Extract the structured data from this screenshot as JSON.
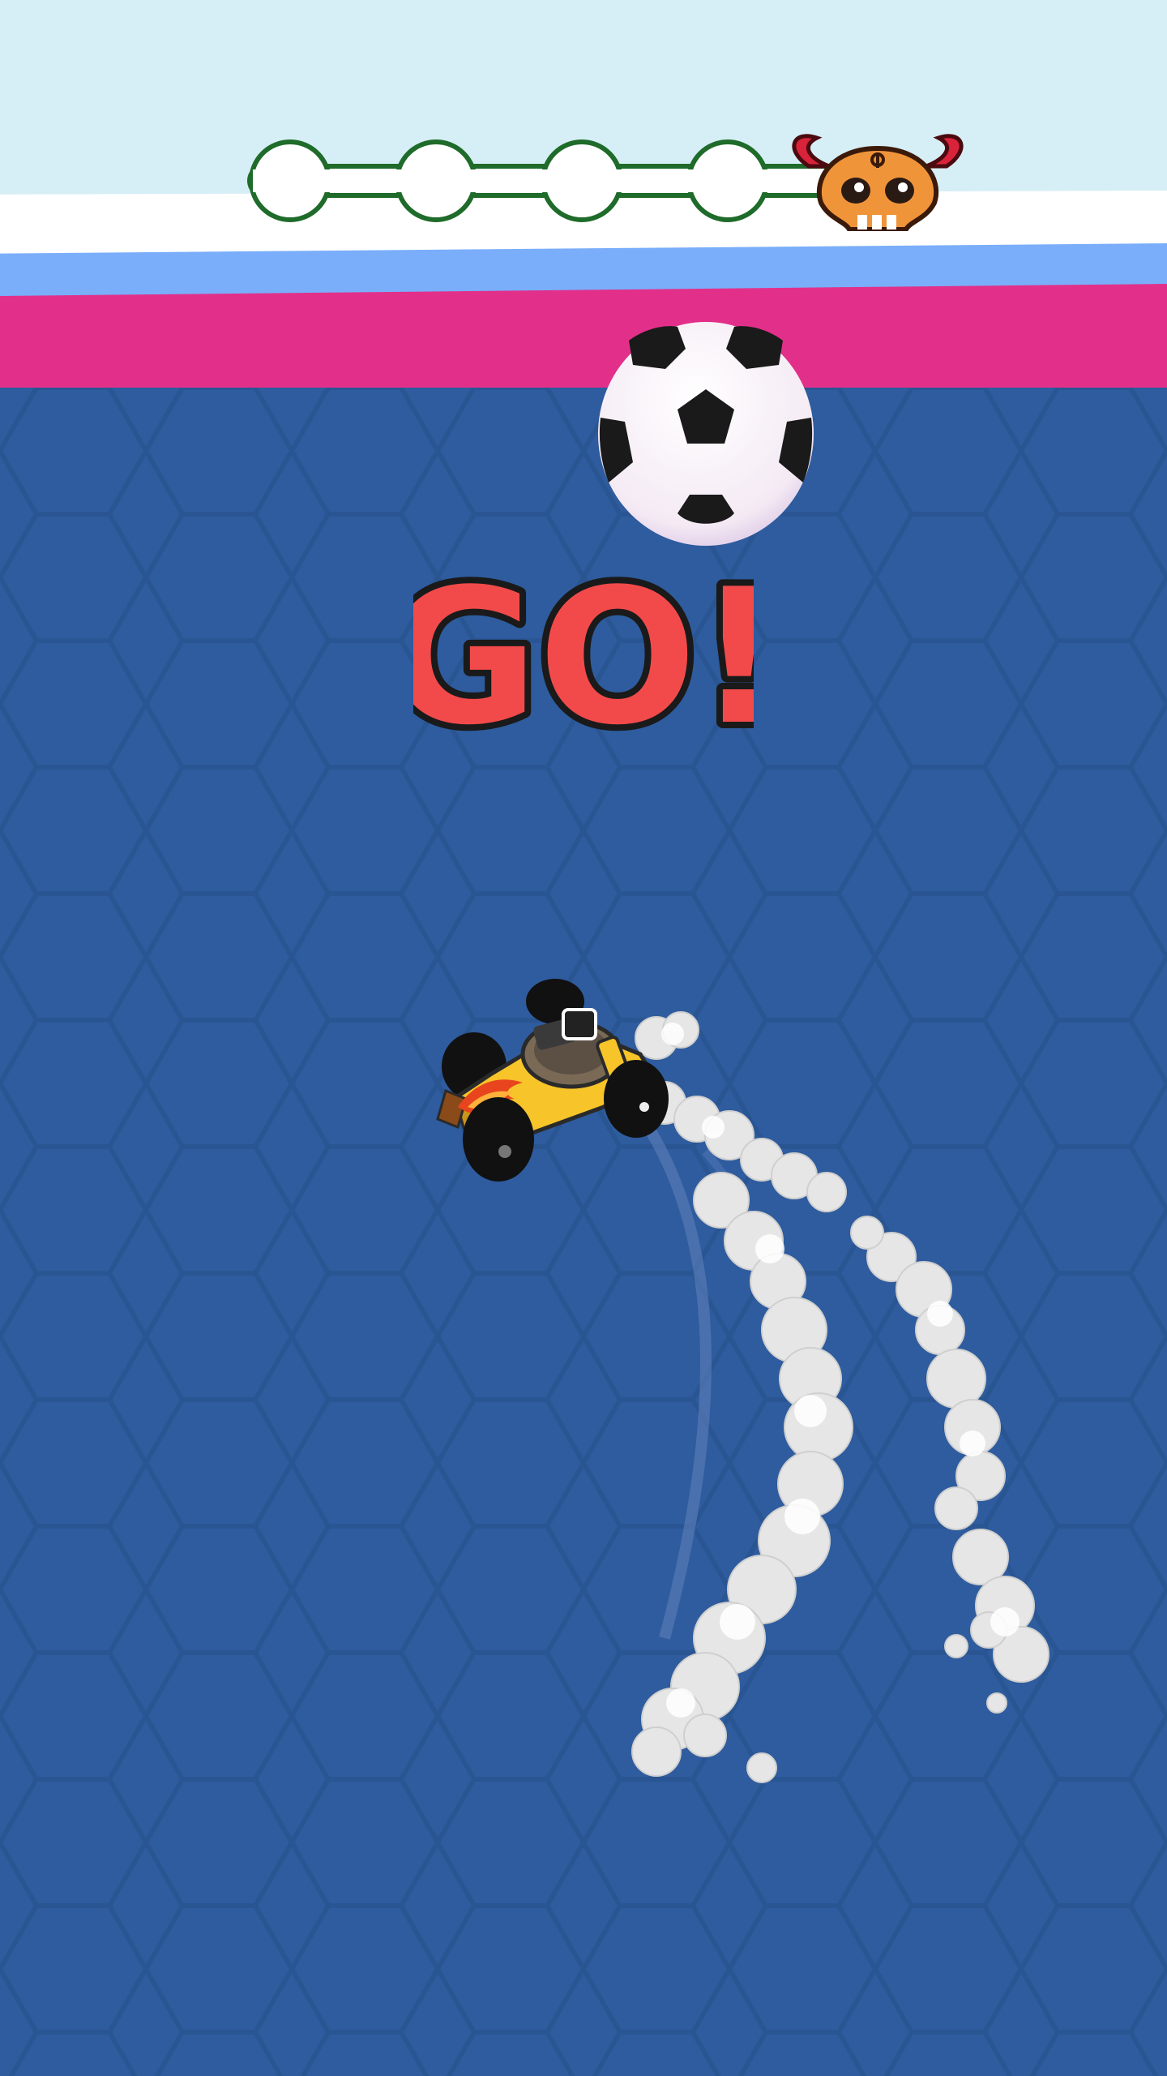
{
  "hud": {
    "level_progress": {
      "nodes_total": 4,
      "nodes_completed": 0,
      "boss_icon": "horned-skull-icon"
    }
  },
  "banner": {
    "text": "GO!"
  },
  "colors": {
    "sky": "#d6eef5",
    "wall_white": "#ffffff",
    "wall_light_blue": "#7aaefa",
    "wall_pink": "#e2308a",
    "field": "#2e5c9e",
    "hex_lines": "#2a5593",
    "progress_outline": "#1e6b2a",
    "go_fill": "#f24a4a",
    "car_body": "#f7c42a"
  },
  "scene": {
    "ball_icon": "soccer-ball-icon",
    "player_icon": "yellow-buggy-car-icon"
  }
}
